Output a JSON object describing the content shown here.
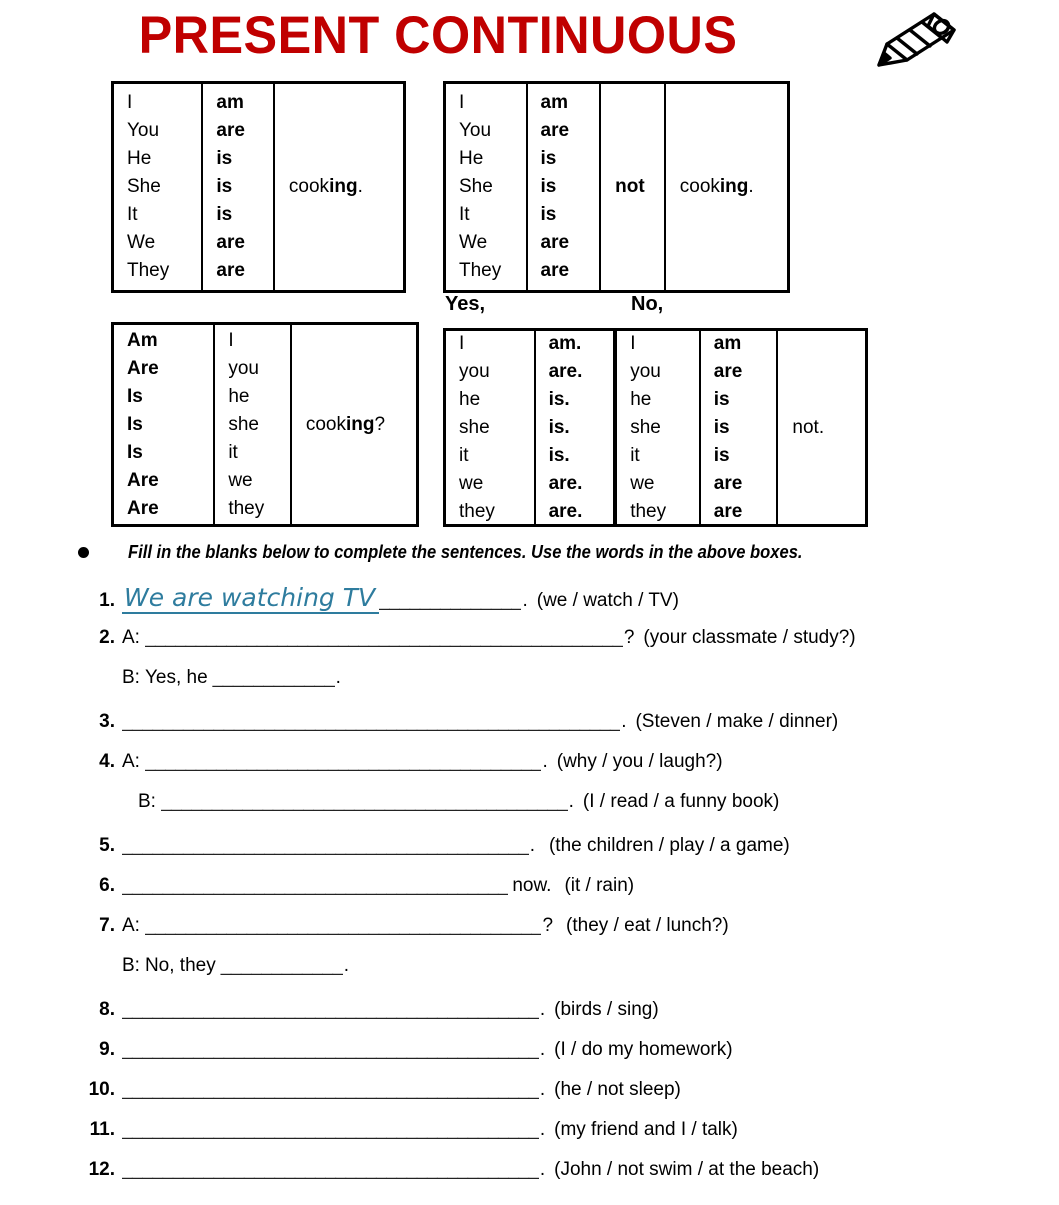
{
  "title": "PRESENT CONTINUOUS",
  "icons": {
    "pencil": "pencil-icon"
  },
  "colors": {
    "title_red": "#C00000",
    "answer_teal": "#2E7C9E",
    "text": "#000000"
  },
  "tables": {
    "affirmative": {
      "subjects": [
        "I",
        "You",
        "He",
        "She",
        "It",
        "We",
        "They"
      ],
      "be": [
        "am",
        "are",
        "is",
        "is",
        "is",
        "are",
        "are"
      ],
      "verb": "cooking."
    },
    "negative": {
      "subjects": [
        "I",
        "You",
        "He",
        "She",
        "It",
        "We",
        "They"
      ],
      "be": [
        "am",
        "are",
        "is",
        "is",
        "is",
        "are",
        "are"
      ],
      "not": "not",
      "verb": "cooking."
    },
    "question": {
      "be": [
        "Am",
        "Are",
        "Is",
        "Is",
        "Is",
        "Are",
        "Are"
      ],
      "subjects": [
        "I",
        "you",
        "he",
        "she",
        "it",
        "we",
        "they"
      ],
      "verb": "cooking?"
    },
    "short_answers": {
      "yes_label": "Yes,",
      "no_label": "No,",
      "yes_subjects": [
        "I",
        "you",
        "he",
        "she",
        "it",
        "we",
        "they"
      ],
      "yes_be": [
        "am.",
        "are.",
        "is.",
        "is.",
        "is.",
        "are.",
        "are."
      ],
      "no_subjects": [
        "I",
        "you",
        "he",
        "she",
        "it",
        "we",
        "they"
      ],
      "no_be": [
        "am",
        "are",
        "is",
        "is",
        "is",
        "are",
        "are"
      ],
      "not": "not."
    }
  },
  "instruction": "Fill in the blanks below to complete the sentences.  Use the words in the above boxes.",
  "exercises": [
    {
      "num": "1.",
      "answer": "We are watching TV",
      "blank": "______________",
      "punct": ".",
      "cue": "(we / watch / TV)"
    },
    {
      "num": "2.",
      "speaker": "A:",
      "blank": "_______________________________________________",
      "punct": "?",
      "cue": "(your classmate / study?)",
      "sub": {
        "speaker": "B:",
        "pre": "Yes, he",
        "blank": "____________",
        "punct": "."
      }
    },
    {
      "num": "3.",
      "blank": "_________________________________________________",
      "punct": ".",
      "cue": "(Steven / make / dinner)"
    },
    {
      "num": "4.",
      "speaker": "A:",
      "blank": "_______________________________________",
      "punct": ".",
      "cue": "(why / you / laugh?)",
      "sub": {
        "speaker": "B:",
        "blank": "________________________________________",
        "punct": ".",
        "cue": "(I / read / a funny book)"
      }
    },
    {
      "num": "5.",
      "blank": "________________________________________",
      "punct": ".",
      "cue": "(the children / play / a game)"
    },
    {
      "num": "6.",
      "blank": "______________________________________",
      "mid": "now.",
      "cue": "(it / rain)"
    },
    {
      "num": "7.",
      "speaker": "A:",
      "blank": "_______________________________________",
      "punct": "?",
      "cue": "(they / eat / lunch?)",
      "sub": {
        "speaker": "B:",
        "pre": "No, they",
        "blank": "____________",
        "punct": "."
      }
    },
    {
      "num": "8.",
      "blank": "_________________________________________",
      "punct": ".",
      "cue": "(birds / sing)"
    },
    {
      "num": "9.",
      "blank": "_________________________________________",
      "punct": ".",
      "cue": "(I / do my homework)"
    },
    {
      "num": "10.",
      "blank": "_________________________________________",
      "punct": ".",
      "cue": "(he / not sleep)"
    },
    {
      "num": "11.",
      "blank": "_________________________________________",
      "punct": ".",
      "cue": "(my friend and I / talk)"
    },
    {
      "num": "12.",
      "blank": "_________________________________________",
      "punct": ".",
      "cue": "(John / not swim / at the beach)"
    }
  ]
}
